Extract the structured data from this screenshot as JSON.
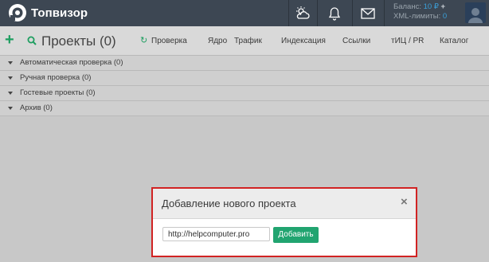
{
  "app": {
    "name": "Топвизор"
  },
  "topbar": {
    "icons": [
      "weather-icon",
      "bell-icon",
      "mail-icon"
    ],
    "balance_label": "Баланс:",
    "balance_value": "10 ₽",
    "xml_label": "XML-лимиты:",
    "xml_value": "0"
  },
  "toolbar": {
    "title": "Проекты (0)",
    "check": "Проверка",
    "columns": [
      "Ядро",
      "Трафик",
      "Индексация",
      "Ссылки",
      "тИЦ / PR",
      "Каталог"
    ]
  },
  "groups": [
    {
      "label": "Автоматическая проверка (0)"
    },
    {
      "label": "Ручная проверка (0)"
    },
    {
      "label": "Гостевые проекты (0)"
    },
    {
      "label": "Архив (0)"
    }
  ],
  "modal": {
    "title": "Добавление нового проекта",
    "close": "×",
    "input_value": "http://helpcomputer.pro",
    "add_button": "Добавить"
  },
  "colors": {
    "topbar": "#3d4753",
    "accent_green": "#21a470",
    "link_blue": "#3b9fd8",
    "highlight_red": "#d12323"
  }
}
